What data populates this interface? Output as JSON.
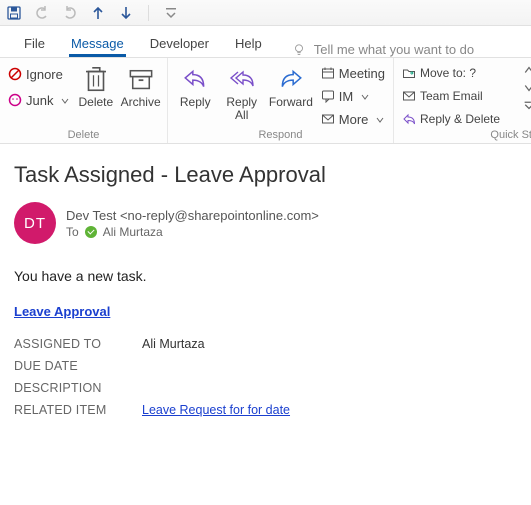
{
  "qat": {
    "save": "save",
    "undo": "undo",
    "redo": "redo",
    "prev": "prev",
    "next": "next",
    "customize": "customize"
  },
  "tabs": {
    "file": "File",
    "message": "Message",
    "developer": "Developer",
    "help": "Help",
    "tellme": "Tell me what you want to do"
  },
  "ribbon": {
    "delete_group": "Delete",
    "ignore": "Ignore",
    "junk": "Junk",
    "delete": "Delete",
    "archive": "Archive",
    "respond_group": "Respond",
    "reply": "Reply",
    "replyall": "Reply\nAll",
    "forward": "Forward",
    "meeting": "Meeting",
    "im": "IM",
    "more": "More",
    "quicksteps_group": "Quick St",
    "moveto": "Move to: ?",
    "teamemail": "Team Email",
    "replydelete": "Reply & Delete"
  },
  "mail": {
    "subject": "Task Assigned - Leave Approval",
    "avatar_initials": "DT",
    "from_display": "Dev Test <no-reply@sharepointonline.com>",
    "to_label": "To",
    "to_name": "Ali Murtaza",
    "body_intro": "You have a new task.",
    "task_link": "Leave Approval",
    "fields": {
      "assigned_to_label": "ASSIGNED TO",
      "assigned_to_value": "Ali Murtaza",
      "due_date_label": "DUE DATE",
      "due_date_value": "",
      "description_label": "DESCRIPTION",
      "description_value": "",
      "related_label": "RELATED ITEM",
      "related_link": "Leave Request for for date"
    }
  }
}
